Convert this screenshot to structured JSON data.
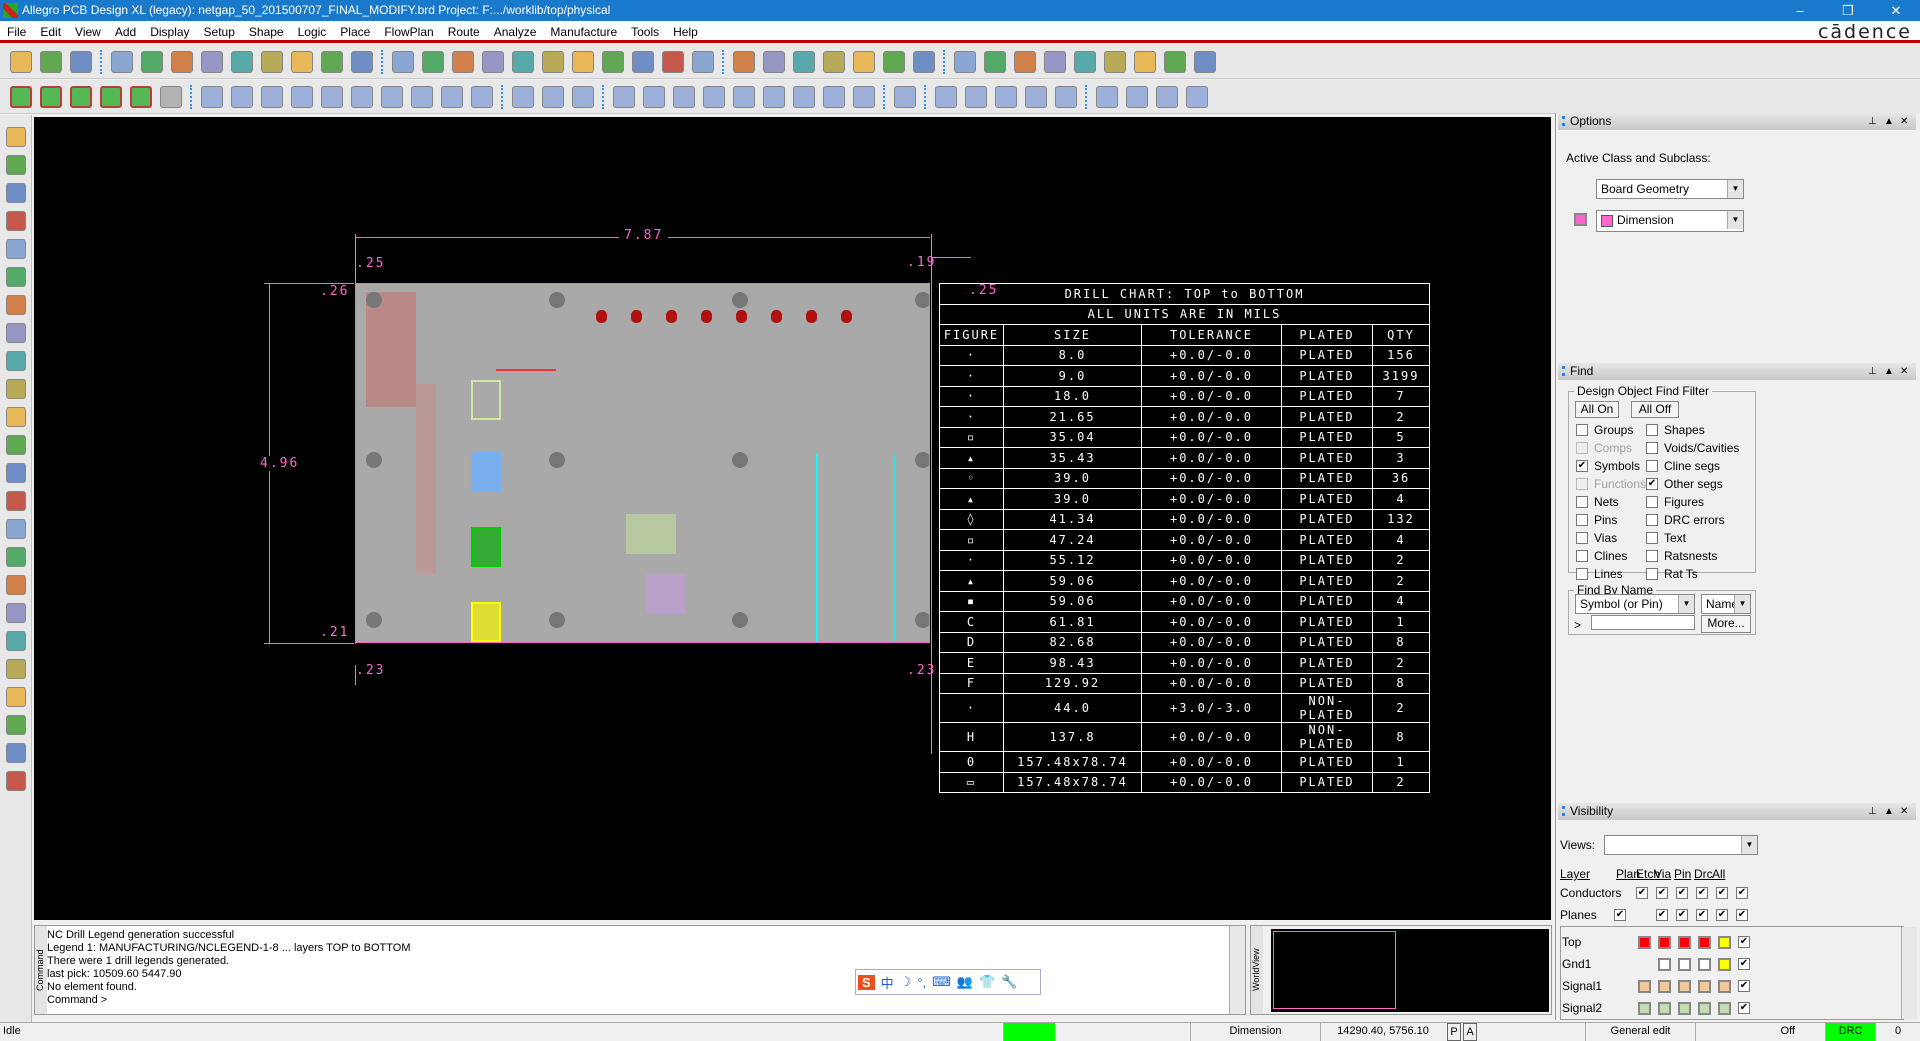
{
  "window": {
    "title": "Allegro PCB Design XL (legacy): netgap_50_201500707_FINAL_MODIFY.brd  Project: F:.../worklib/top/physical",
    "minimize": "–",
    "restore": "❐",
    "close": "✕",
    "brand": "cādence"
  },
  "menu": [
    "File",
    "Edit",
    "View",
    "Add",
    "Display",
    "Setup",
    "Shape",
    "Logic",
    "Place",
    "FlowPlan",
    "Route",
    "Analyze",
    "Manufacture",
    "Tools",
    "Help"
  ],
  "toolbar1": [
    "new-icon",
    "open-icon",
    "save-icon",
    "|",
    "move-icon",
    "copy-icon",
    "delete-icon",
    "undo-icon",
    "redo-down-icon",
    "redo-icon",
    "redo-down2-icon",
    "shape-icon",
    "pin-icon",
    "|",
    "ratsnest-icon",
    "grid-icon",
    "zoom-points-icon",
    "zoom-fit-icon",
    "zoom-in-icon",
    "zoom-out-icon",
    "zoom-prev-icon",
    "zoom-world-icon",
    "redraw-icon",
    "3d-icon",
    "flip-icon",
    "|",
    "grid-toggle-icon",
    "color-icon",
    "layer-icon",
    "stack-icon",
    "etch-icon",
    "drc-icon",
    "board-icon",
    "|",
    "info-icon",
    "report-icon",
    "number-icon",
    "highlight-icon",
    "sun-icon",
    "dehighlight-icon",
    "bars-icon",
    "hourglass-icon",
    "toggle-icon"
  ],
  "toolbar2": [
    "place-icon-1",
    "place-icon-2",
    "place-icon-3",
    "place-icon-4",
    "place-icon-5",
    "disabled-icon",
    "|",
    "add-line-icon",
    "add-rect-icon",
    "add-circle-icon",
    "select-icon",
    "add-frect-icon",
    "arc-icon",
    "rect-icon",
    "circle-icon",
    "shape-slot-icon",
    "delete-shape-icon",
    "|",
    "drc-box-icon",
    "measure-icon",
    "dimension-icon",
    "|",
    "odb-icon",
    "padstack-icon",
    "probe-icon",
    "camera-icon",
    "fab-icon",
    "legend-icon",
    "board-outline-icon",
    "drill-icon",
    "grid-array-icon",
    "|",
    "route-icon",
    "|",
    "page-icon",
    "book-icon",
    "gift-icon",
    "check-icon",
    "wrench-icon",
    "|",
    "window-icon",
    "mail-icon",
    "frame-icon",
    "help-icon"
  ],
  "lefttoolbar": [
    "place-manual-icon",
    "component-icon",
    "connector-icon",
    "add-connect-icon",
    "slide-icon",
    "delay-tune-icon",
    "custom-smooth-icon",
    "spread-icon",
    "vertex-icon",
    "glossing-icon",
    "fanout-icon",
    "line-icon",
    "rectangle-icon",
    "add-text-icon",
    "edit-text-icon",
    "route-a-icon",
    "route-b-icon",
    "route-c-icon",
    "route-d-icon",
    "route-e-icon",
    "route-f-icon",
    "route-g-icon",
    "route-h-icon",
    "route-i-icon"
  ],
  "colors": {
    "dimension": "#ff66cc",
    "titlebar": "#1979ca",
    "menu_rule": "#c00000",
    "canvas": "#000000",
    "board": "#a9a9a9",
    "status_green": "#00ff00"
  },
  "board": {
    "width_label": "7.87",
    "height_label": "4.96",
    "left_margin_top": ".25",
    "right_margin_top": ".19",
    "top_offset": ".26",
    "bottom_offset": ".21",
    "left_margin_bottom": ".23",
    "right_margin_bottom": ".23",
    "chart_offset": ".25"
  },
  "drill_chart": {
    "title": "DRILL CHART: TOP to BOTTOM",
    "subtitle": "ALL UNITS ARE IN MILS",
    "headers": [
      "FIGURE",
      "SIZE",
      "TOLERANCE",
      "PLATED",
      "QTY"
    ],
    "rows": [
      [
        "·",
        "8.0",
        "+0.0/-0.0",
        "PLATED",
        "156"
      ],
      [
        "·",
        "9.0",
        "+0.0/-0.0",
        "PLATED",
        "3199"
      ],
      [
        "·",
        "18.0",
        "+0.0/-0.0",
        "PLATED",
        "7"
      ],
      [
        "·",
        "21.65",
        "+0.0/-0.0",
        "PLATED",
        "2"
      ],
      [
        "▫",
        "35.04",
        "+0.0/-0.0",
        "PLATED",
        "5"
      ],
      [
        "▴",
        "35.43",
        "+0.0/-0.0",
        "PLATED",
        "3"
      ],
      [
        "◦",
        "39.0",
        "+0.0/-0.0",
        "PLATED",
        "36"
      ],
      [
        "▴",
        "39.0",
        "+0.0/-0.0",
        "PLATED",
        "4"
      ],
      [
        "◊",
        "41.34",
        "+0.0/-0.0",
        "PLATED",
        "132"
      ],
      [
        "▫",
        "47.24",
        "+0.0/-0.0",
        "PLATED",
        "4"
      ],
      [
        "·",
        "55.12",
        "+0.0/-0.0",
        "PLATED",
        "2"
      ],
      [
        "▴",
        "59.06",
        "+0.0/-0.0",
        "PLATED",
        "2"
      ],
      [
        "▪",
        "59.06",
        "+0.0/-0.0",
        "PLATED",
        "4"
      ],
      [
        "C",
        "61.81",
        "+0.0/-0.0",
        "PLATED",
        "1"
      ],
      [
        "D",
        "82.68",
        "+0.0/-0.0",
        "PLATED",
        "8"
      ],
      [
        "E",
        "98.43",
        "+0.0/-0.0",
        "PLATED",
        "2"
      ],
      [
        "F",
        "129.92",
        "+0.0/-0.0",
        "PLATED",
        "8"
      ],
      [
        "·",
        "44.0",
        "+3.0/-3.0",
        "NON-PLATED",
        "2"
      ],
      [
        "H",
        "137.8",
        "+0.0/-0.0",
        "NON-PLATED",
        "8"
      ],
      [
        "0",
        "157.48x78.74",
        "+0.0/-0.0",
        "PLATED",
        "1"
      ],
      [
        "▭",
        "157.48x78.74",
        "+0.0/-0.0",
        "PLATED",
        "2"
      ]
    ]
  },
  "options": {
    "title": "Options",
    "label": "Active Class and Subclass:",
    "class_value": "Board Geometry",
    "subclass_value": "Dimension"
  },
  "find": {
    "title": "Find",
    "filter_label": "Design Object Find Filter",
    "all_on": "All On",
    "all_off": "All Off",
    "items": [
      {
        "label": "Groups",
        "checked": false,
        "enabled": true
      },
      {
        "label": "Shapes",
        "checked": false,
        "enabled": true
      },
      {
        "label": "Comps",
        "checked": false,
        "enabled": false
      },
      {
        "label": "Voids/Cavities",
        "checked": false,
        "enabled": true
      },
      {
        "label": "Symbols",
        "checked": true,
        "enabled": true
      },
      {
        "label": "Cline segs",
        "checked": false,
        "enabled": true
      },
      {
        "label": "Functions",
        "checked": false,
        "enabled": false
      },
      {
        "label": "Other segs",
        "checked": true,
        "enabled": true
      },
      {
        "label": "Nets",
        "checked": false,
        "enabled": true
      },
      {
        "label": "Figures",
        "checked": false,
        "enabled": true
      },
      {
        "label": "Pins",
        "checked": false,
        "enabled": true
      },
      {
        "label": "DRC errors",
        "checked": false,
        "enabled": true
      },
      {
        "label": "Vias",
        "checked": false,
        "enabled": true
      },
      {
        "label": "Text",
        "checked": false,
        "enabled": true
      },
      {
        "label": "Clines",
        "checked": false,
        "enabled": true
      },
      {
        "label": "Ratsnests",
        "checked": false,
        "enabled": true
      },
      {
        "label": "Lines",
        "checked": false,
        "enabled": true
      },
      {
        "label": "Rat Ts",
        "checked": false,
        "enabled": true
      }
    ],
    "by_name_label": "Find By Name",
    "type_value": "Symbol (or Pin)",
    "name_value": "Name",
    "prompt": ">",
    "name_input": "",
    "more": "More..."
  },
  "visibility": {
    "title": "Visibility",
    "views_label": "Views:",
    "views_value": "",
    "columns": [
      "Layer",
      "Plan",
      "Etch",
      "Via",
      "Pin",
      "Drc",
      "All"
    ],
    "groups": [
      {
        "label": "Conductors",
        "checks": [
          false,
          true,
          true,
          true,
          true,
          true,
          true
        ],
        "plan_shown": false
      },
      {
        "label": "Planes",
        "checks": [
          true,
          false,
          true,
          true,
          true,
          true,
          true
        ],
        "etch_shown": false
      }
    ],
    "layers": [
      {
        "name": "Top",
        "colors": [
          "#ff0000",
          "#ff0000",
          "#ff0000",
          "#ff0000",
          "#ffff00"
        ],
        "all": true
      },
      {
        "name": "Gnd1",
        "colors": [
          null,
          "#ffffff",
          "#ffffff",
          "#ffffff",
          "#ffff00"
        ],
        "all": true
      },
      {
        "name": "Signal1",
        "colors": [
          "#f5c89a",
          "#f5c89a",
          "#f5c89a",
          "#f5c89a",
          "#f5c89a"
        ],
        "all": true
      },
      {
        "name": "Signal2",
        "colors": [
          "#c4ddb0",
          "#c4ddb0",
          "#c4ddb0",
          "#c4ddb0",
          "#c4ddb0"
        ],
        "all": true
      }
    ]
  },
  "command": {
    "side_label": "Command",
    "lines": [
      "NC Drill Legend generation successful",
      "Legend 1: MANUFACTURING/NCLEGEND-1-8 ... layers TOP to BOTTOM",
      "There were 1 drill legends generated.",
      "last pick:  10509.60  5447.90",
      "No element found.",
      "Command >"
    ],
    "ime_items": [
      "S",
      "中",
      "☽",
      "°,",
      "⌨",
      "👥",
      "👕",
      "🔧"
    ]
  },
  "worldview": {
    "side_label": "WorldView"
  },
  "status": {
    "state": "Idle",
    "class": "Dimension",
    "coords": "14290.40, 5756.10",
    "p": "P",
    "a": "A",
    "mode": "General edit",
    "off": "Off",
    "drc": "DRC",
    "count": "0"
  }
}
